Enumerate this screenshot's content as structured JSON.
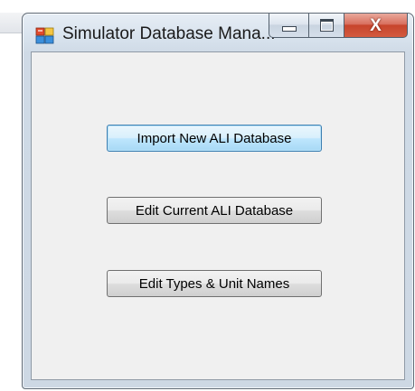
{
  "window": {
    "title": "Simulator Database Mana...",
    "icon": "database-app-icon",
    "caption_buttons": {
      "minimize": "minimize-icon",
      "maximize": "maximize-icon",
      "close": "close-icon"
    }
  },
  "buttons": {
    "import_label": "Import New ALI Database",
    "edit_ali_label": "Edit Current ALI Database",
    "edit_types_label": "Edit Types & Unit Names"
  },
  "colors": {
    "close_button": "#c7442c",
    "focused_button_border": "#3c7fb1",
    "client_background": "#f0f0f0"
  }
}
